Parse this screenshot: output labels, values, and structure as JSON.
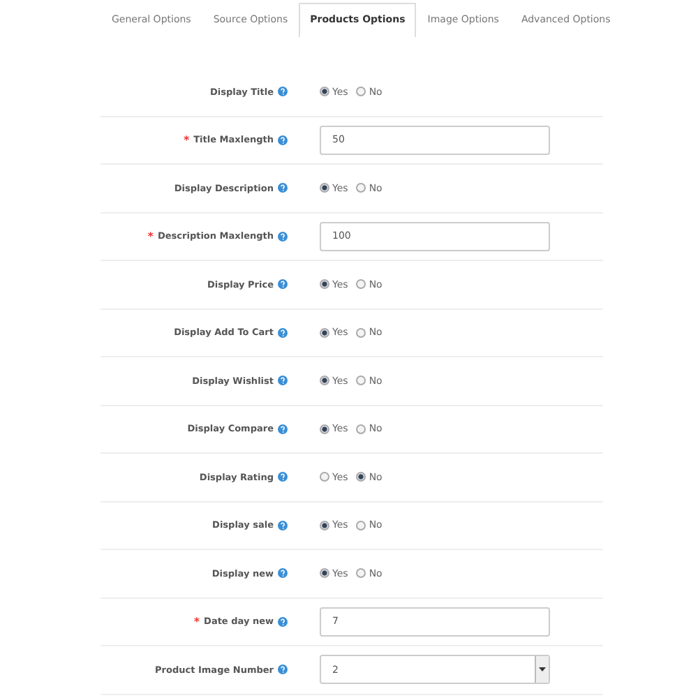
{
  "tabs": [
    {
      "label": "General Options",
      "selected": false
    },
    {
      "label": "Source Options",
      "selected": false
    },
    {
      "label": "Products Options",
      "selected": true
    },
    {
      "label": "Image Options",
      "selected": false
    },
    {
      "label": "Advanced Options",
      "selected": false
    }
  ],
  "fields": [
    {
      "kind": "radio",
      "label": "Display Title",
      "options": [
        {
          "label": "Yes",
          "selected": true
        },
        {
          "label": "No",
          "selected": false
        }
      ]
    },
    {
      "kind": "text",
      "required_mark": "*",
      "label": "Title Maxlength",
      "value": "50"
    },
    {
      "kind": "radio",
      "label": "Display Description",
      "options": [
        {
          "label": "Yes",
          "selected": true
        },
        {
          "label": "No",
          "selected": false
        }
      ]
    },
    {
      "kind": "text",
      "required_mark": "*",
      "label": "Description Maxlength",
      "value": "100"
    },
    {
      "kind": "radio",
      "label": "Display Price",
      "options": [
        {
          "label": "Yes",
          "selected": true
        },
        {
          "label": "No",
          "selected": false
        }
      ]
    },
    {
      "kind": "radio",
      "label": "Display Add To Cart",
      "options": [
        {
          "label": "Yes",
          "selected": true
        },
        {
          "label": "No",
          "selected": false
        }
      ]
    },
    {
      "kind": "radio",
      "label": "Display Wishlist",
      "options": [
        {
          "label": "Yes",
          "selected": true
        },
        {
          "label": "No",
          "selected": false
        }
      ]
    },
    {
      "kind": "radio",
      "label": "Display Compare",
      "options": [
        {
          "label": "Yes",
          "selected": true
        },
        {
          "label": "No",
          "selected": false
        }
      ]
    },
    {
      "kind": "radio",
      "label": "Display Rating",
      "options": [
        {
          "label": "Yes",
          "selected": false
        },
        {
          "label": "No",
          "selected": true
        }
      ]
    },
    {
      "kind": "radio",
      "label": "Display sale",
      "options": [
        {
          "label": "Yes",
          "selected": true
        },
        {
          "label": "No",
          "selected": false
        }
      ]
    },
    {
      "kind": "radio",
      "label": "Display new",
      "options": [
        {
          "label": "Yes",
          "selected": true
        },
        {
          "label": "No",
          "selected": false
        }
      ]
    },
    {
      "kind": "text",
      "required_mark": "*",
      "label": "Date day new",
      "value": "7"
    },
    {
      "kind": "select",
      "label": "Product Image Number",
      "value": "2"
    }
  ]
}
